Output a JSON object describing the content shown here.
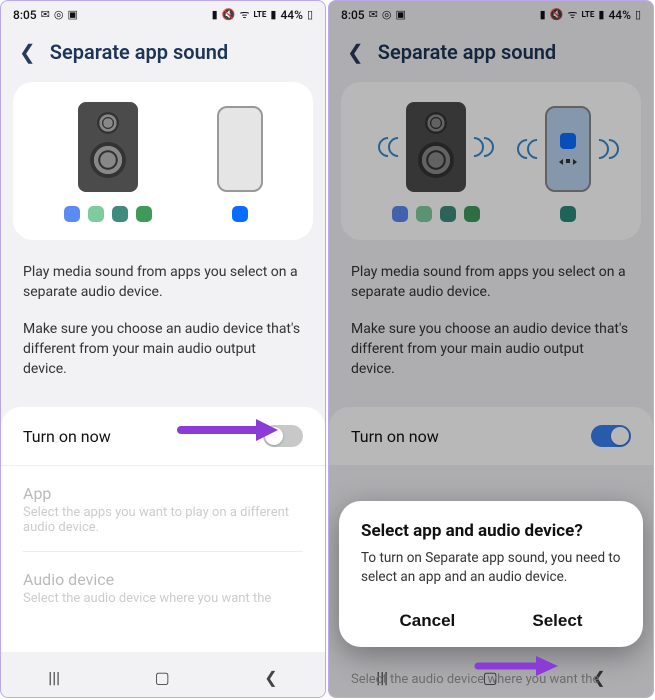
{
  "status": {
    "time": "8:05",
    "battery_pct": "44%"
  },
  "header": {
    "title": "Separate app sound"
  },
  "desc": {
    "p1": "Play media sound from apps you select on a separate audio device.",
    "p2": "Make sure you choose an audio device that's different from your main audio output device."
  },
  "toggle": {
    "label": "Turn on now"
  },
  "list": {
    "app": {
      "title": "App",
      "sub": "Select the apps you want to play on a different audio device."
    },
    "device": {
      "title": "Audio device",
      "sub": "Select the audio device where you want the"
    }
  },
  "dialog": {
    "title": "Select app and audio device?",
    "body": "To turn on Separate app sound, you need to select an app and an audio device.",
    "cancel": "Cancel",
    "select": "Select"
  }
}
